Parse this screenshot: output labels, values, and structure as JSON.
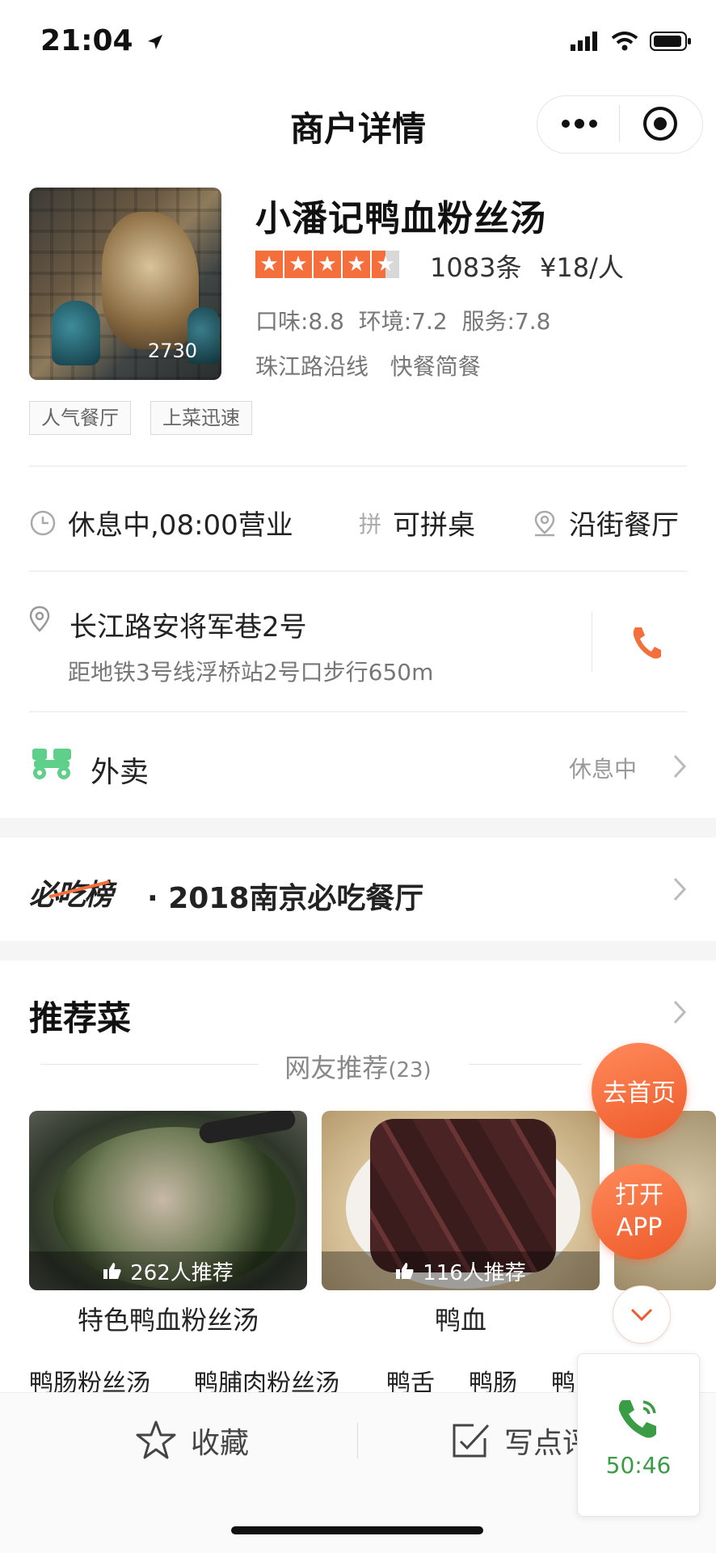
{
  "status_bar": {
    "time": "21:04"
  },
  "nav": {
    "title": "商户详情"
  },
  "shop": {
    "photo_count": "2730",
    "name": "小潘记鸭血粉丝汤",
    "rating": 4.5,
    "review_count": "1083条",
    "price": "¥18/人",
    "scores": "口味:8.8  环境:7.2  服务:7.8",
    "district_category": "珠江路沿线   快餐简餐",
    "tags": [
      "人气餐厅",
      "上菜迅速"
    ]
  },
  "info_row": {
    "hours": "休息中,08:00营业",
    "share_table_icon_text": "拼",
    "share_table": "可拼桌",
    "street": "沿街餐厅"
  },
  "address": {
    "line": "长江路安将军巷2号",
    "distance": "距地铁3号线浮桥站2号口步行650m"
  },
  "takeaway": {
    "label": "外卖",
    "status": "休息中"
  },
  "must_eat": {
    "logo": "必吃榜",
    "title": "· 2018南京必吃餐厅"
  },
  "recommend": {
    "title": "推荐菜",
    "subtitle": "网友推荐",
    "subtitle_count": "(23)",
    "dishes": [
      {
        "name": "特色鸭血粉丝汤",
        "badge": "262人推荐"
      },
      {
        "name": "鸭血",
        "badge": "116人推荐"
      }
    ],
    "more": [
      "鸭肠粉丝汤",
      "鸭脯肉粉丝汤",
      "鸭舌",
      "鸭肠",
      "鸭"
    ]
  },
  "floating": {
    "home": "去首页",
    "open_app_line1": "打开",
    "open_app_line2": "APP"
  },
  "bottom_bar": {
    "favorite": "收藏",
    "write_review": "写点评"
  },
  "call_widget": {
    "timer": "50:46"
  },
  "colors": {
    "accent": "#f46f3c",
    "green": "#3a9c45",
    "takeaway_green": "#5ed08a"
  }
}
